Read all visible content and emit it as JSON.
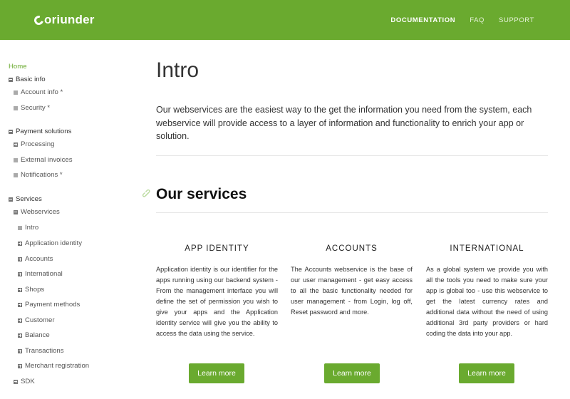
{
  "header": {
    "logo_text": "oriunder",
    "nav": [
      {
        "label": "DOCUMENTATION"
      },
      {
        "label": "FAQ"
      },
      {
        "label": "SUPPORT"
      }
    ],
    "colors": {
      "brand": "#6aaa2f",
      "text": "#ffffff"
    }
  },
  "sidebar": {
    "items": [
      {
        "label": "Home"
      },
      {
        "label": "Basic info"
      },
      {
        "label": "Account info *"
      },
      {
        "label": "Security *"
      },
      {
        "label": "Payment solutions"
      },
      {
        "label": "Processing"
      },
      {
        "label": "External invoices"
      },
      {
        "label": "Notifications *"
      },
      {
        "label": "Services"
      },
      {
        "label": "Webservices"
      },
      {
        "label": "Intro"
      },
      {
        "label": "Application identity"
      },
      {
        "label": "Accounts"
      },
      {
        "label": "International"
      },
      {
        "label": "Shops"
      },
      {
        "label": "Payment methods"
      },
      {
        "label": "Customer"
      },
      {
        "label": "Balance"
      },
      {
        "label": "Transactions"
      },
      {
        "label": "Merchant registration"
      },
      {
        "label": "SDK"
      }
    ]
  },
  "main": {
    "title": "Intro",
    "intro": "Our webservices are the easiest way to the get the information you need from the system, each webservice will provide access to a layer of information and functionality to enrich your app or solution.",
    "section_title": "Our services",
    "services": [
      {
        "title": "APP IDENTITY",
        "text": "Application identity is our identifier for the apps running using our backend system - From the management interface you will define the set of permission you wish to give your apps and the Application identity service will give you the ability to access the data using the service.",
        "button": "Learn more"
      },
      {
        "title": "ACCOUNTS",
        "text": "The Accounts webservice is the base of our user management - get easy access to all the basic functionality needed for user management - from Login, log off, Reset password and more.",
        "button": "Learn more"
      },
      {
        "title": "INTERNATIONAL",
        "text": "As a global system we provide you with all the tools you need to make sure your app is global too - use this webservice to get the latest currency rates and additional data without the need of using additional 3rd party providers or hard coding the data into your app.",
        "button": "Learn more"
      }
    ]
  }
}
